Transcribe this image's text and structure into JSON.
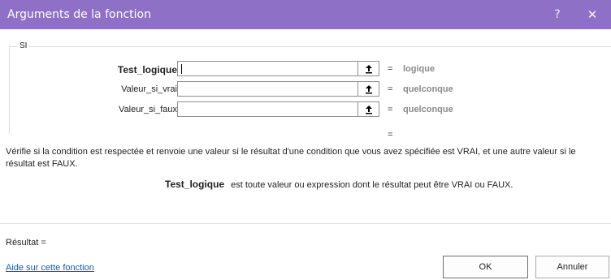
{
  "window": {
    "title": "Arguments de la fonction",
    "help_glyph": "?",
    "close_glyph": "✕"
  },
  "group": {
    "label": "SI",
    "args": [
      {
        "name": "Test_logique",
        "value": "",
        "eq": "=",
        "result": "logique",
        "bold": true
      },
      {
        "name": "Valeur_si_vrai",
        "value": "",
        "eq": "=",
        "result": "quelconque",
        "bold": false
      },
      {
        "name": "Valeur_si_faux",
        "value": "",
        "eq": "=",
        "result": "quelconque",
        "bold": false
      }
    ],
    "overall_eq": "="
  },
  "description": "Vérifie si la condition est respectée et renvoie une valeur si le résultat d'une condition que vous avez spécifiée est VRAI, et une autre valeur si le résultat est FAUX.",
  "arg_description": {
    "name": "Test_logique",
    "text": "est toute valeur ou expression dont le résultat peut être VRAI ou FAUX."
  },
  "result_label": "Résultat =",
  "help_link": "Aide sur cette fonction",
  "buttons": {
    "ok": "OK",
    "cancel": "Annuler"
  },
  "icons": {
    "ref_button": "collapse-dialog-up-arrow-icon"
  }
}
